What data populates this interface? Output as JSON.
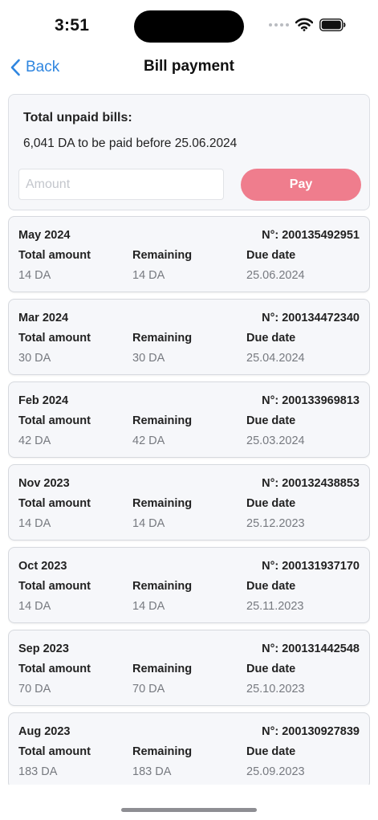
{
  "status_bar": {
    "time": "3:51"
  },
  "nav": {
    "back_label": "Back",
    "title": "Bill payment"
  },
  "summary": {
    "title": "Total unpaid bills:",
    "text": "6,041 DA to be paid before 25.06.2024",
    "amount_placeholder": "Amount",
    "pay_label": "Pay"
  },
  "labels": {
    "total_amount": "Total amount",
    "remaining": "Remaining",
    "due_date": "Due date"
  },
  "bills": [
    {
      "month": "May 2024",
      "number": "N°: 200135492951",
      "total": "14 DA",
      "remaining": "14 DA",
      "due": "25.06.2024"
    },
    {
      "month": "Mar 2024",
      "number": "N°: 200134472340",
      "total": "30 DA",
      "remaining": "30 DA",
      "due": "25.04.2024"
    },
    {
      "month": "Feb 2024",
      "number": "N°: 200133969813",
      "total": "42 DA",
      "remaining": "42 DA",
      "due": "25.03.2024"
    },
    {
      "month": "Nov 2023",
      "number": "N°: 200132438853",
      "total": "14 DA",
      "remaining": "14 DA",
      "due": "25.12.2023"
    },
    {
      "month": "Oct 2023",
      "number": "N°: 200131937170",
      "total": "14 DA",
      "remaining": "14 DA",
      "due": "25.11.2023"
    },
    {
      "month": "Sep 2023",
      "number": "N°: 200131442548",
      "total": "70 DA",
      "remaining": "70 DA",
      "due": "25.10.2023"
    },
    {
      "month": "Aug 2023",
      "number": "N°: 200130927839",
      "total": "183 DA",
      "remaining": "183 DA",
      "due": "25.09.2023"
    }
  ],
  "colors": {
    "accent": "#2f86e0",
    "pay_button": "#ef7d8d",
    "card_bg": "#f6f7fa"
  },
  "icons": {
    "back": "chevron-left-icon",
    "wifi": "wifi-icon",
    "battery": "battery-icon",
    "signal": "cellular-signal-icon"
  }
}
